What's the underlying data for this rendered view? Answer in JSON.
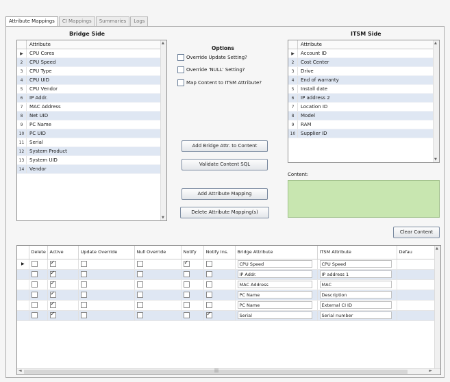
{
  "tabs": [
    {
      "label": "Attribute Mappings",
      "active": true
    },
    {
      "label": "CI Mappings",
      "active": false
    },
    {
      "label": "Summaries",
      "active": false
    },
    {
      "label": "Logs",
      "active": false
    }
  ],
  "bridge_side": {
    "title": "Bridge Side",
    "header": "Attribute",
    "rows": [
      {
        "num": "▶",
        "label": "CPU Cores"
      },
      {
        "num": "2",
        "label": "CPU Speed"
      },
      {
        "num": "3",
        "label": "CPU Type"
      },
      {
        "num": "4",
        "label": "CPU UID"
      },
      {
        "num": "5",
        "label": "CPU Vendor"
      },
      {
        "num": "6",
        "label": "IP Addr."
      },
      {
        "num": "7",
        "label": "MAC Address"
      },
      {
        "num": "8",
        "label": "Net UID"
      },
      {
        "num": "9",
        "label": "PC Name"
      },
      {
        "num": "10",
        "label": "PC UID"
      },
      {
        "num": "11",
        "label": "Serial"
      },
      {
        "num": "12",
        "label": "System Product"
      },
      {
        "num": "13",
        "label": "System UID"
      },
      {
        "num": "14",
        "label": "Vendor"
      }
    ]
  },
  "itsm_side": {
    "title": "ITSM Side",
    "header": "Attribute",
    "rows": [
      {
        "num": "▶",
        "label": "Account ID"
      },
      {
        "num": "2",
        "label": "Cost Center"
      },
      {
        "num": "3",
        "label": "Drive"
      },
      {
        "num": "4",
        "label": "End of warranty"
      },
      {
        "num": "5",
        "label": "Install date"
      },
      {
        "num": "6",
        "label": "IP address 2"
      },
      {
        "num": "7",
        "label": "Location ID"
      },
      {
        "num": "8",
        "label": "Model"
      },
      {
        "num": "9",
        "label": "RAM"
      },
      {
        "num": "10",
        "label": "Supplier ID"
      }
    ]
  },
  "options": {
    "title": "Options",
    "override_update": "Override Update Setting?",
    "override_null": "Override 'NULL' Setting?",
    "map_content": "Map Content to ITSM Attribute?"
  },
  "buttons": {
    "add_bridge_to_content": "Add Bridge Attr. to Content",
    "validate_sql": "Validate Content SQL",
    "add_mapping": "Add Attribute Mapping",
    "delete_mapping": "Delete Attribute Mapping(s)",
    "clear_content": "Clear Content"
  },
  "content_label": "Content:",
  "grid": {
    "headers": [
      "",
      "Delete",
      "Active",
      "Update Override",
      "Null Override",
      "Notify",
      "Notify Ins.",
      "Bridge Attribute",
      "ITSM Attribute",
      "Defau"
    ],
    "rows": [
      {
        "marker": "▶",
        "delete": false,
        "active": true,
        "update": false,
        "null": false,
        "notify": true,
        "notify_ins": false,
        "bridge": "CPU Speed",
        "itsm": "CPU Speed"
      },
      {
        "marker": "",
        "delete": false,
        "active": true,
        "update": false,
        "null": false,
        "notify": false,
        "notify_ins": false,
        "bridge": "IP Addr.",
        "itsm": "IP address 1"
      },
      {
        "marker": "",
        "delete": false,
        "active": true,
        "update": false,
        "null": false,
        "notify": false,
        "notify_ins": false,
        "bridge": "MAC Address",
        "itsm": "MAC"
      },
      {
        "marker": "",
        "delete": false,
        "active": true,
        "update": false,
        "null": false,
        "notify": false,
        "notify_ins": false,
        "bridge": "PC Name",
        "itsm": "Description"
      },
      {
        "marker": "",
        "delete": false,
        "active": true,
        "update": false,
        "null": false,
        "notify": false,
        "notify_ins": false,
        "bridge": "PC Name",
        "itsm": "External CI ID"
      },
      {
        "marker": "",
        "delete": false,
        "active": true,
        "update": false,
        "null": false,
        "notify": false,
        "notify_ins": true,
        "bridge": "Serial",
        "itsm": "Serial number"
      }
    ]
  },
  "colors": {
    "content_box": "#c8e6b0",
    "row_alt": "#dfe7f3"
  }
}
